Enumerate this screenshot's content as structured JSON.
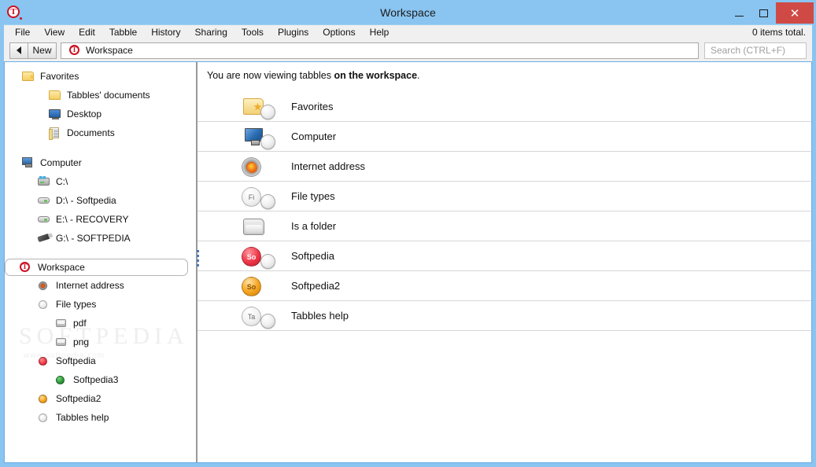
{
  "window": {
    "title": "Workspace",
    "app_icon": "tabbles-logo-icon",
    "minimize_label": "–",
    "maximize_label": "□",
    "close_label": "✕",
    "accent_color": "#8ac4f0",
    "close_color": "#d04a45"
  },
  "menubar": {
    "items": [
      {
        "label": "File"
      },
      {
        "label": "View"
      },
      {
        "label": "Edit"
      },
      {
        "label": "Tabble"
      },
      {
        "label": "History"
      },
      {
        "label": "Sharing"
      },
      {
        "label": "Tools"
      },
      {
        "label": "Plugins"
      },
      {
        "label": "Options"
      },
      {
        "label": "Help"
      }
    ],
    "items_total": "0 items total."
  },
  "toolbar": {
    "back_label": "",
    "new_label": "New",
    "address_icon": "tabbles-logo-icon",
    "address_value": "Workspace",
    "search_placeholder": "Search (CTRL+F)"
  },
  "sidebar": {
    "watermark": "SOFTPEDIA",
    "watermark_sub": "www.softpedia.com",
    "groups": [
      {
        "label": "Favorites",
        "icon": "folder-star-icon",
        "indent": 0,
        "selected": false,
        "children": [
          {
            "label": "Tabbles' documents",
            "icon": "folder-icon",
            "indent": 1,
            "selected": false
          },
          {
            "label": "Desktop",
            "icon": "desktop-icon",
            "indent": 1,
            "selected": false
          },
          {
            "label": "Documents",
            "icon": "documents-icon",
            "indent": 1,
            "selected": false
          }
        ]
      },
      {
        "label": "Computer",
        "icon": "computer-icon",
        "indent": 0,
        "selected": false,
        "children": [
          {
            "label": "C:\\",
            "icon": "drive-windows-icon",
            "indent": 1,
            "selected": false
          },
          {
            "label": "D:\\ - Softpedia",
            "icon": "drive-icon",
            "indent": 1,
            "selected": false
          },
          {
            "label": "E:\\ - RECOVERY",
            "icon": "drive-icon",
            "indent": 1,
            "selected": false
          },
          {
            "label": "G:\\ - SOFTPEDIA",
            "icon": "usb-drive-icon",
            "indent": 1,
            "selected": false
          }
        ]
      },
      {
        "label": "Workspace",
        "icon": "tabbles-logo-icon",
        "indent": 0,
        "selected": true,
        "children": [
          {
            "label": "Internet address",
            "icon": "firefox-dot-icon",
            "indent": 1,
            "selected": false
          },
          {
            "label": "File types",
            "icon": "grey-dot-icon",
            "indent": 1,
            "selected": false
          },
          {
            "label": "pdf",
            "icon": "tile-icon",
            "indent": 2,
            "selected": false
          },
          {
            "label": "png",
            "icon": "tile-icon",
            "indent": 2,
            "selected": false
          },
          {
            "label": "Softpedia",
            "icon": "red-dot-icon",
            "indent": 1,
            "selected": false
          },
          {
            "label": "Softpedia3",
            "icon": "green-dot-icon",
            "indent": 2,
            "selected": false
          },
          {
            "label": "Softpedia2",
            "icon": "orange-dot-icon",
            "indent": 1,
            "selected": false
          },
          {
            "label": "Tabbles help",
            "icon": "grey-dot-icon",
            "indent": 1,
            "selected": false
          }
        ]
      }
    ]
  },
  "content": {
    "header_prefix": "You are now viewing tabbles ",
    "header_bold": "on the workspace",
    "header_suffix": ".",
    "rows": [
      {
        "label": "Favorites",
        "icon": "folder-star-badge-icon",
        "badge": true,
        "kind": "folder-star"
      },
      {
        "label": "Computer",
        "icon": "computer-badge-icon",
        "badge": true,
        "kind": "monitor"
      },
      {
        "label": "Internet address",
        "icon": "firefox-icon",
        "badge": false,
        "kind": "firefox",
        "abbr": ""
      },
      {
        "label": "File types",
        "icon": "file-types-badge-icon",
        "badge": true,
        "kind": "circle-grey",
        "abbr": "Fi"
      },
      {
        "label": "Is a folder",
        "icon": "grey-folder-icon",
        "badge": false,
        "kind": "grey-folder"
      },
      {
        "label": "Softpedia",
        "icon": "softpedia-badge-icon",
        "badge": true,
        "kind": "circle-red",
        "abbr": "So"
      },
      {
        "label": "Softpedia2",
        "icon": "softpedia2-icon",
        "badge": false,
        "kind": "circle-orange",
        "abbr": "So"
      },
      {
        "label": "Tabbles help",
        "icon": "tabbles-help-badge-icon",
        "badge": true,
        "kind": "circle-grey",
        "abbr": "Ta"
      }
    ]
  }
}
